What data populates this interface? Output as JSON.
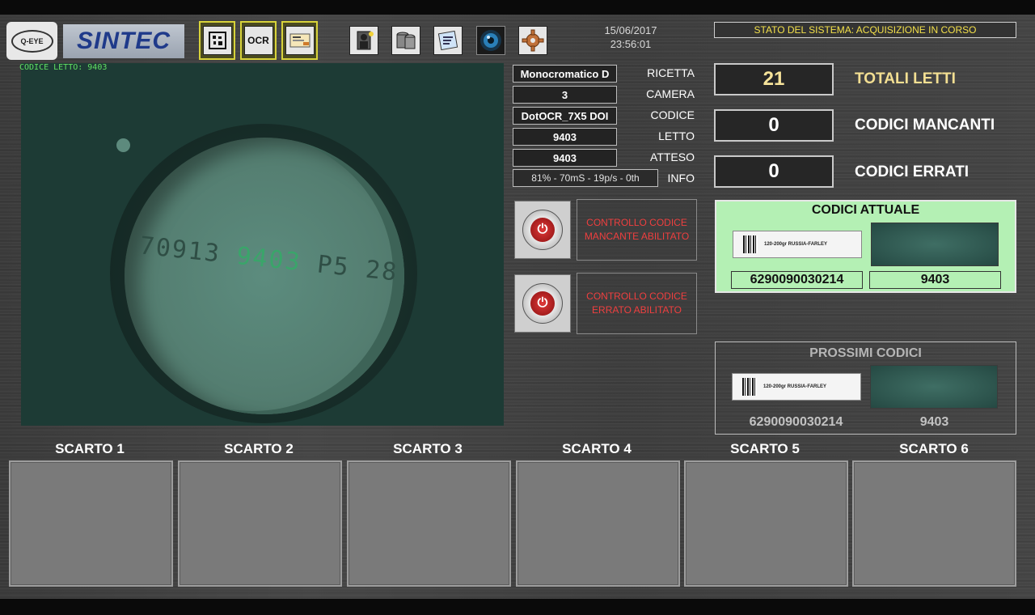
{
  "toolbar": {
    "logo_qeye": "Q-EYE",
    "logo_sintec": "SINTEC",
    "tool_ocr": "OCR"
  },
  "datetime": {
    "date": "15/06/2017",
    "time": "23:56:01"
  },
  "status": "STATO DEL SISTEMA: ACQUISIZIONE IN CORSO",
  "camera": {
    "overlay": "CODICE LETTO: 9403",
    "cap_text_a": "70913",
    "cap_text_b": "9403",
    "cap_text_c": "P5 28"
  },
  "params": [
    {
      "value": "Monocromatico D",
      "label": "RICETTA"
    },
    {
      "value": "3",
      "label": "CAMERA"
    },
    {
      "value": "DotOCR_7X5 DOI",
      "label": "CODICE"
    },
    {
      "value": "9403",
      "label": "LETTO"
    },
    {
      "value": "9403",
      "label": "ATTESO"
    }
  ],
  "info": {
    "value": "81% - 70mS - 19p/s - 0th",
    "label": "INFO"
  },
  "controls": [
    {
      "label": "CONTROLLO CODICE MANCANTE ABILITATO"
    },
    {
      "label": "CONTROLLO CODICE ERRATO ABILITATO"
    }
  ],
  "counters": [
    {
      "value": "21",
      "label": "TOTALI LETTI"
    },
    {
      "value": "0",
      "label": "CODICI MANCANTI"
    },
    {
      "value": "0",
      "label": "CODICI ERRATI"
    }
  ],
  "current": {
    "title": "CODICI ATTUALE",
    "label_text": "120-200gr RUSSIA-FARLEY",
    "barcode": "6290090030214",
    "code": "9403"
  },
  "next": {
    "title": "PROSSIMI CODICI",
    "label_text": "120-200gr RUSSIA-FARLEY",
    "barcode": "6290090030214",
    "code": "9403"
  },
  "rejects": [
    "SCARTO 1",
    "SCARTO 2",
    "SCARTO 3",
    "SCARTO 4",
    "SCARTO 5",
    "SCARTO 6"
  ],
  "colors": {
    "accent_green": "#b4f0b4",
    "status_yellow": "#f3e04a",
    "alert_red": "#ef3f3f",
    "ocr_green": "#62e062"
  }
}
